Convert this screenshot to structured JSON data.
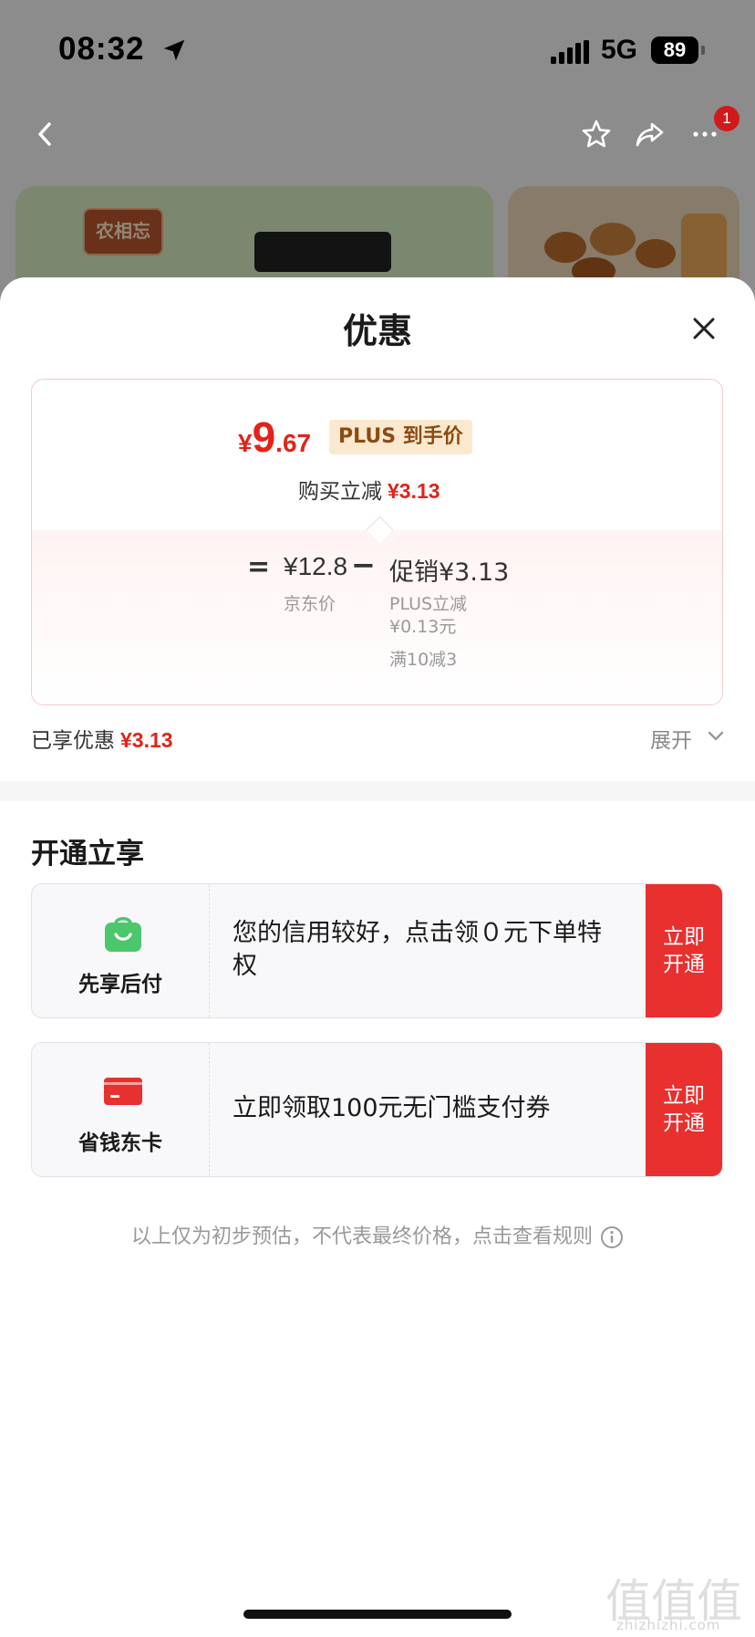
{
  "status_bar": {
    "time": "08:32",
    "network": "5G",
    "battery": "89"
  },
  "background_page": {
    "brand_logo_text": "农相忘",
    "cart_badge": "1"
  },
  "sheet": {
    "title": "优惠",
    "price_card": {
      "currency": "¥",
      "final_price_int": "9",
      "final_price_dec": ".67",
      "plus_tag": "PLUS 到手价",
      "buy_reduce_label": "购买立减",
      "buy_reduce_value": "¥3.13",
      "equals": "=",
      "jd_price": "¥12.8",
      "jd_price_label": "京东价",
      "minus": "−",
      "promo": "促销¥3.13",
      "promo_detail_1": "PLUS立减",
      "promo_detail_1_value": "¥0.13元",
      "promo_detail_2": "满10减3"
    },
    "enjoyed_label": "已享优惠",
    "enjoyed_value": "¥3.13",
    "expand_label": "展开",
    "section_title": "开通立享",
    "offers": [
      {
        "icon": "green-bag-icon",
        "name": "先享后付",
        "desc": "您的信用较好，点击领０元下单特权",
        "button": "立即开通"
      },
      {
        "icon": "red-card-icon",
        "name": "省钱东卡",
        "desc": "立即领取100元无门槛支付券",
        "button": "立即开通"
      }
    ],
    "disclaimer": "以上仅为初步预估，不代表最终价格，点击查看规则"
  },
  "watermark": {
    "text": "zhizhizhi.com",
    "glyphs": "值值值"
  },
  "colors": {
    "accent_red": "#e2231a",
    "button_red": "#e8302f",
    "plus_tag_bg": "#fbe9cf",
    "green": "#4cc76b"
  }
}
